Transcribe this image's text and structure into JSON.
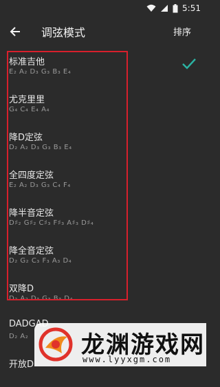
{
  "status": {
    "time": "5:51"
  },
  "header": {
    "title": "调弦模式",
    "sort_label": "排序"
  },
  "tunings": [
    {
      "name": "标准吉他",
      "notes": "E₂ A₂ D₃ G₃ B₃ E₄",
      "selected": true
    },
    {
      "name": "尤克里里",
      "notes": "G₄ C₄ E₄ A₄"
    },
    {
      "name": "降D定弦",
      "notes": "D₂ A₂ D₃ G₃ B₃ E₄"
    },
    {
      "name": "全四度定弦",
      "notes": "E₂ A₂ D₃ G₃ C₄ F₄"
    },
    {
      "name": "降半音定弦",
      "notes": "D♯₂ G♯₂ C♯₃ F♯₃ A♯₃ D♯₄"
    },
    {
      "name": "降全音定弦",
      "notes": "D₂ G₂ C₃ F₃ A₃ D₄"
    },
    {
      "name": "双降D",
      "notes": "D₂ A₂ D₃ G₃ B₃ D₄"
    },
    {
      "name": "DADGAD",
      "notes": "D₂ A₂"
    },
    {
      "name": "开放D",
      "notes": ""
    }
  ],
  "colors": {
    "accent": "#2bb3a3",
    "highlight": "#d8202c"
  },
  "watermark": {
    "name": "龙渊游戏网",
    "url": "www.lyyxgm.com"
  }
}
